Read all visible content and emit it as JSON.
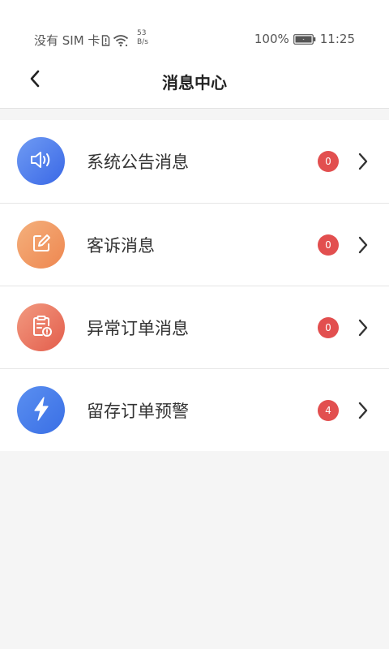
{
  "status_bar": {
    "carrier": "没有 SIM 卡",
    "net_speed_value": "53",
    "net_speed_unit": "B/s",
    "battery_percent": "100%",
    "time": "11:25",
    "icons": [
      "sim-alert-icon",
      "wifi-icon",
      "battery-charging-icon"
    ]
  },
  "nav": {
    "title": "消息中心",
    "back_icon": "chevron-left-icon"
  },
  "colors": {
    "badge": "#e24f4f",
    "announcement_icon": [
      "#5b8cf0",
      "#3a68e6"
    ],
    "complaint_icon": [
      "#f3a56f",
      "#ef8a55"
    ],
    "exception_icon": [
      "#f08a73",
      "#e8614f"
    ],
    "retention_icon": [
      "#4d84ee",
      "#3b72e6"
    ]
  },
  "items": [
    {
      "label": "系统公告消息",
      "count": "0",
      "icon": "speaker-icon"
    },
    {
      "label": "客诉消息",
      "count": "0",
      "icon": "edit-icon"
    },
    {
      "label": "异常订单消息",
      "count": "0",
      "icon": "order-alert-icon"
    },
    {
      "label": "留存订单预警",
      "count": "4",
      "icon": "lightning-icon"
    }
  ]
}
